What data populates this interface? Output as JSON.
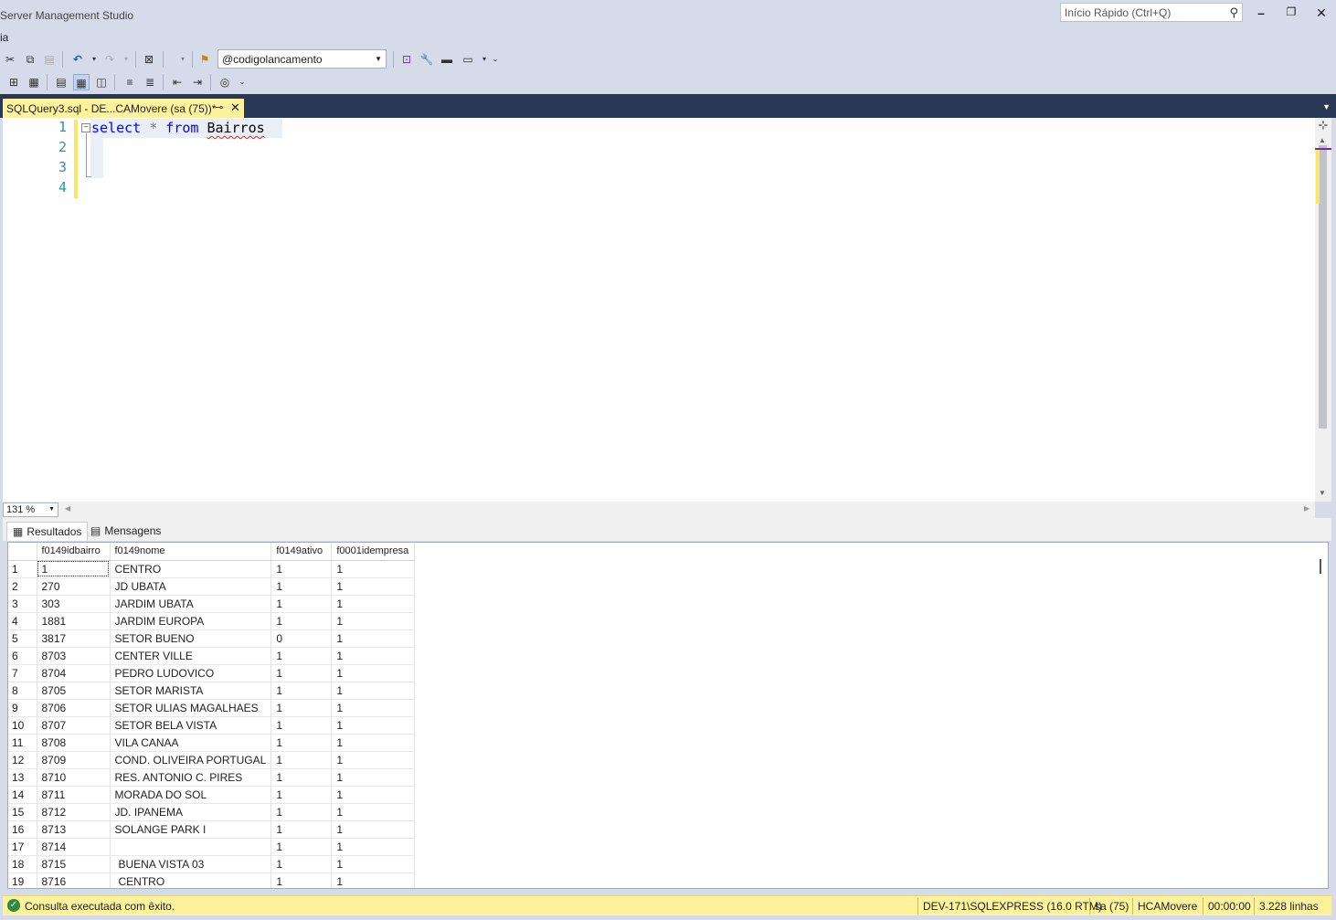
{
  "window": {
    "title": "Server Management Studio",
    "quick_launch_placeholder": "Início Rápido (Ctrl+Q)"
  },
  "menu": {
    "partial_item": "ia"
  },
  "toolbar": {
    "database_combo_value": "@codigolancamento"
  },
  "document_tab": {
    "label": "SQLQuery3.sql - DE...CAMovere (sa (75))*"
  },
  "editor": {
    "line_numbers": [
      "1",
      "2",
      "3",
      "4"
    ],
    "code": {
      "kw_select": "select",
      "op_star": "*",
      "kw_from": "from",
      "table": "Bairros"
    },
    "zoom": "131 %"
  },
  "results": {
    "tabs": [
      {
        "label": "Resultados",
        "icon": "grid-icon"
      },
      {
        "label": "Mensagens",
        "icon": "messages-icon"
      }
    ],
    "columns": [
      "f0149idbairro",
      "f0149nome",
      "f0149ativo",
      "f0001idempresa"
    ],
    "rows": [
      [
        "1",
        "1",
        "CENTRO",
        "1",
        "1"
      ],
      [
        "2",
        "270",
        "JD UBATA",
        "1",
        "1"
      ],
      [
        "3",
        "303",
        "JARDIM UBATA",
        "1",
        "1"
      ],
      [
        "4",
        "1881",
        "JARDIM EUROPA",
        "1",
        "1"
      ],
      [
        "5",
        "3817",
        "SETOR BUENO",
        "0",
        "1"
      ],
      [
        "6",
        "8703",
        "CENTER VILLE",
        "1",
        "1"
      ],
      [
        "7",
        "8704",
        "PEDRO LUDOVICO",
        "1",
        "1"
      ],
      [
        "8",
        "8705",
        "SETOR MARISTA",
        "1",
        "1"
      ],
      [
        "9",
        "8706",
        "SETOR ULIAS MAGALHAES",
        "1",
        "1"
      ],
      [
        "10",
        "8707",
        "SETOR BELA VISTA",
        "1",
        "1"
      ],
      [
        "11",
        "8708",
        "VILA CANAA",
        "1",
        "1"
      ],
      [
        "12",
        "8709",
        "COND. OLIVEIRA PORTUGAL",
        "1",
        "1"
      ],
      [
        "13",
        "8710",
        "RES. ANTONIO C. PIRES",
        "1",
        "1"
      ],
      [
        "14",
        "8711",
        "MORADA DO SOL",
        "1",
        "1"
      ],
      [
        "15",
        "8712",
        "JD. IPANEMA",
        "1",
        "1"
      ],
      [
        "16",
        "8713",
        "SOLANGE PARK I",
        "1",
        "1"
      ],
      [
        "17",
        "8714",
        "",
        "1",
        "1"
      ],
      [
        "18",
        "8715",
        " BUENA VISTA 03",
        "1",
        "1"
      ],
      [
        "19",
        "8716",
        " CENTRO",
        "1",
        "1"
      ]
    ]
  },
  "status": {
    "message": "Consulta executada com êxito.",
    "server": "DEV-171\\SQLEXPRESS (16.0 RTM)",
    "user": "sa (75)",
    "database": "HCAMovere",
    "elapsed": "00:00:00",
    "rows": "3.228 linhas",
    "bar_color": "#fff29d"
  }
}
